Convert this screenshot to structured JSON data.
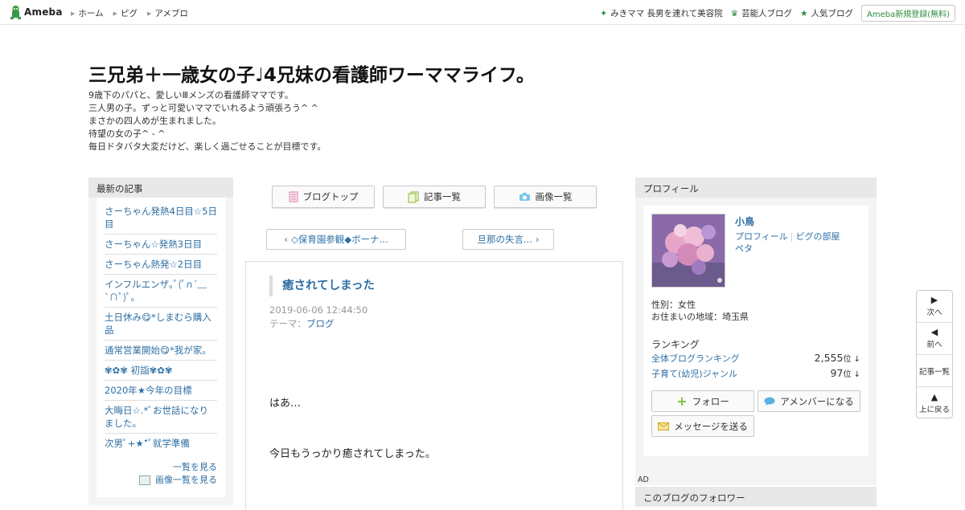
{
  "topbar": {
    "logo_text": "Ameba",
    "nav": [
      "ホーム",
      "ピグ",
      "アメブロ"
    ],
    "right_links": [
      {
        "icon": "sparkle-icon",
        "label": "みきママ 長男を連れて美容院"
      },
      {
        "icon": "crown-icon",
        "label": "芸能人ブログ"
      },
      {
        "icon": "star-icon",
        "label": "人気ブログ"
      }
    ],
    "register_label": "Ameba新規登録(無料)"
  },
  "header": {
    "title": "三兄弟＋一歳女の子♩4兄妹の看護師ワーママライフ。",
    "description": [
      "9歳下のパパと、愛しいⅢメンズの看護師ママです。",
      "三人男の子。ずっと可愛いママでいれるよう頑張ろう^ ^",
      "まさかの四人めが生まれました。",
      "待望の女の子^ - ^",
      "毎日ドタバタ大変だけど、楽しく過ごせることが目標です。"
    ]
  },
  "recent": {
    "heading": "最新の記事",
    "items": [
      "さーちゃん発熱4日目☆5日目",
      "さーちゃん☆発熱3日目",
      "さーちゃん熱発☆2日目",
      "インフルエンザ｡ﾟ(ﾟ∩´﹏`∩ﾟ)ﾟ｡",
      "土日休み😋*しまむら購入品",
      "通常営業開始😋*我が家。",
      "✾✿✾ 初詣✾✿✾",
      "2020年★今年の目標",
      "大晦日☆.*ﾟお世話になりました。",
      "次男ﾟ+★*ﾟ就学準備"
    ],
    "more_label": "一覧を見る",
    "images_label": "画像一覧を見る"
  },
  "buttons": {
    "blog_top": "ブログトップ",
    "entry_list": "記事一覧",
    "image_list": "画像一覧"
  },
  "pager": {
    "prev": "◇保育園参観◆ボーナ...",
    "next": "旦那の失言..."
  },
  "entry": {
    "title": "癒されてしまった",
    "date": "2019-06-06 12:44:50",
    "theme_label": "テーマ：",
    "theme": "ブログ",
    "body": [
      "はあ…",
      "今日もうっかり癒されてしまった。"
    ]
  },
  "profile": {
    "heading": "プロフィール",
    "name": "小鳥",
    "link_profile": "プロフィール",
    "link_pigg": "ピグの部屋",
    "link_peta": "ペタ",
    "gender": "性別：女性",
    "region": "お住まいの地域：埼玉県",
    "ranking_heading": "ランキング",
    "rankings": [
      {
        "label": "全体ブログランキング",
        "value": "2,555",
        "unit": "位 ↓"
      },
      {
        "label": "子育て(幼児)ジャンル",
        "value": "97",
        "unit": "位 ↓"
      }
    ],
    "follow_label": "フォロー",
    "amember_label": "アメンバーになる",
    "message_label": "メッセージを送る"
  },
  "ad_label": "AD",
  "followers_heading": "このブログのフォロワー",
  "sidenav": {
    "next": "次へ",
    "prev": "前へ",
    "list": "記事一覧",
    "top": "上に戻る"
  }
}
